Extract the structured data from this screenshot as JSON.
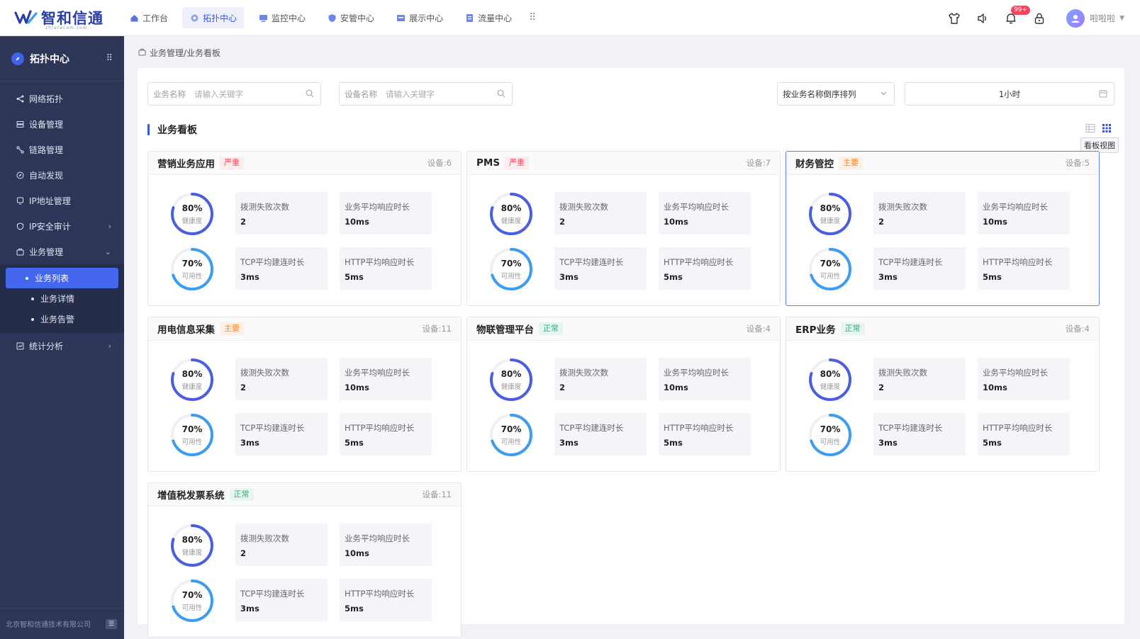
{
  "app": {
    "logo_text": "智和信通",
    "logo_sub": "zhtetecom.com",
    "nav": [
      {
        "label": "工作台",
        "icon": "home-icon",
        "active": false
      },
      {
        "label": "拓扑中心",
        "icon": "topology-icon",
        "active": true
      },
      {
        "label": "监控中心",
        "icon": "monitor-icon",
        "active": false
      },
      {
        "label": "安管中心",
        "icon": "shield-icon",
        "active": false
      },
      {
        "label": "展示中心",
        "icon": "display-icon",
        "active": false
      },
      {
        "label": "流量中心",
        "icon": "traffic-icon",
        "active": false
      }
    ],
    "notification_count": "99+",
    "username": "啦啦啦"
  },
  "sidebar": {
    "title": "拓扑中心",
    "items": [
      {
        "label": "网络拓扑",
        "icon": "network-icon"
      },
      {
        "label": "设备管理",
        "icon": "device-icon"
      },
      {
        "label": "链路管理",
        "icon": "link-icon"
      },
      {
        "label": "自动发现",
        "icon": "discover-icon"
      },
      {
        "label": "IP地址管理",
        "icon": "ip-icon"
      },
      {
        "label": "IP安全审计",
        "icon": "audit-icon"
      },
      {
        "label": "业务管理",
        "icon": "business-icon"
      }
    ],
    "sub_items": [
      {
        "label": "业务列表",
        "active": true
      },
      {
        "label": "业务详情",
        "active": false
      },
      {
        "label": "业务告警",
        "active": false
      }
    ],
    "after_items": [
      {
        "label": "统计分析",
        "icon": "stats-icon"
      }
    ],
    "footer": "北京智和信通技术有限公司"
  },
  "breadcrumb": "业务管理/业务看板",
  "filters": {
    "business_name_label": "业务名称",
    "business_name_placeholder": "请输入关键字",
    "device_name_label": "设备名称",
    "device_name_placeholder": "请输入关键字",
    "sort_value": "按业务名称倒序排列",
    "time_range": "1小时"
  },
  "section_title": "业务看板",
  "view_tooltip": "看板视图",
  "colors": {
    "accent": "#3a56d4",
    "sidebar_bg": "#2d3656",
    "critical": "#f04c5e",
    "major": "#f08a3c",
    "normal": "#23b47e",
    "health_ring": "#4a5fe0",
    "availability_ring": "#3b9cf0"
  },
  "cards": [
    {
      "name": "营销业务应用",
      "severity": "严重",
      "level": "red",
      "devices": "设备:6",
      "active": false,
      "health": "80%",
      "health_label": "健康度",
      "health_ratio": 0.8,
      "availability": "70%",
      "availability_label": "可用性",
      "availability_ratio": 0.7,
      "metrics": [
        {
          "name": "拨测失败次数",
          "value": "2"
        },
        {
          "name": "业务平均响应时长",
          "value": "10ms"
        },
        {
          "name": "TCP平均建连时长",
          "value": "3ms"
        },
        {
          "name": "HTTP平均响应时长",
          "value": "5ms"
        }
      ]
    },
    {
      "name": "PMS",
      "severity": "严重",
      "level": "red",
      "devices": "设备:7",
      "active": false,
      "health": "80%",
      "health_label": "健康度",
      "health_ratio": 0.8,
      "availability": "70%",
      "availability_label": "可用性",
      "availability_ratio": 0.7,
      "metrics": [
        {
          "name": "拨测失败次数",
          "value": "2"
        },
        {
          "name": "业务平均响应时长",
          "value": "10ms"
        },
        {
          "name": "TCP平均建连时长",
          "value": "3ms"
        },
        {
          "name": "HTTP平均响应时长",
          "value": "5ms"
        }
      ]
    },
    {
      "name": "财务管控",
      "severity": "主要",
      "level": "orange",
      "devices": "设备:5",
      "active": true,
      "health": "80%",
      "health_label": "健康度",
      "health_ratio": 0.8,
      "availability": "70%",
      "availability_label": "可用性",
      "availability_ratio": 0.7,
      "metrics": [
        {
          "name": "拨测失败次数",
          "value": "2"
        },
        {
          "name": "业务平均响应时长",
          "value": "10ms"
        },
        {
          "name": "TCP平均建连时长",
          "value": "3ms"
        },
        {
          "name": "HTTP平均响应时长",
          "value": "5ms"
        }
      ]
    },
    {
      "name": "用电信息采集",
      "severity": "主要",
      "level": "orange",
      "devices": "设备:11",
      "active": false,
      "health": "80%",
      "health_label": "健康度",
      "health_ratio": 0.8,
      "availability": "70%",
      "availability_label": "可用性",
      "availability_ratio": 0.7,
      "metrics": [
        {
          "name": "拨测失败次数",
          "value": "2"
        },
        {
          "name": "业务平均响应时长",
          "value": "10ms"
        },
        {
          "name": "TCP平均建连时长",
          "value": "3ms"
        },
        {
          "name": "HTTP平均响应时长",
          "value": "5ms"
        }
      ]
    },
    {
      "name": "物联管理平台",
      "severity": "正常",
      "level": "green",
      "devices": "设备:4",
      "active": false,
      "health": "80%",
      "health_label": "健康度",
      "health_ratio": 0.8,
      "availability": "70%",
      "availability_label": "可用性",
      "availability_ratio": 0.7,
      "metrics": [
        {
          "name": "拨测失败次数",
          "value": "2"
        },
        {
          "name": "业务平均响应时长",
          "value": "10ms"
        },
        {
          "name": "TCP平均建连时长",
          "value": "3ms"
        },
        {
          "name": "HTTP平均响应时长",
          "value": "5ms"
        }
      ]
    },
    {
      "name": "ERP业务",
      "severity": "正常",
      "level": "green",
      "devices": "设备:4",
      "active": false,
      "health": "80%",
      "health_label": "健康度",
      "health_ratio": 0.8,
      "availability": "70%",
      "availability_label": "可用性",
      "availability_ratio": 0.7,
      "metrics": [
        {
          "name": "拨测失败次数",
          "value": "2"
        },
        {
          "name": "业务平均响应时长",
          "value": "10ms"
        },
        {
          "name": "TCP平均建连时长",
          "value": "3ms"
        },
        {
          "name": "HTTP平均响应时长",
          "value": "5ms"
        }
      ]
    },
    {
      "name": "增值税发票系统",
      "severity": "正常",
      "level": "green",
      "devices": "设备:11",
      "active": false,
      "health": "80%",
      "health_label": "健康度",
      "health_ratio": 0.8,
      "availability": "70%",
      "availability_label": "可用性",
      "availability_ratio": 0.7,
      "metrics": [
        {
          "name": "拨测失败次数",
          "value": "2"
        },
        {
          "name": "业务平均响应时长",
          "value": "10ms"
        },
        {
          "name": "TCP平均建连时长",
          "value": "3ms"
        },
        {
          "name": "HTTP平均响应时长",
          "value": "5ms"
        }
      ]
    }
  ]
}
